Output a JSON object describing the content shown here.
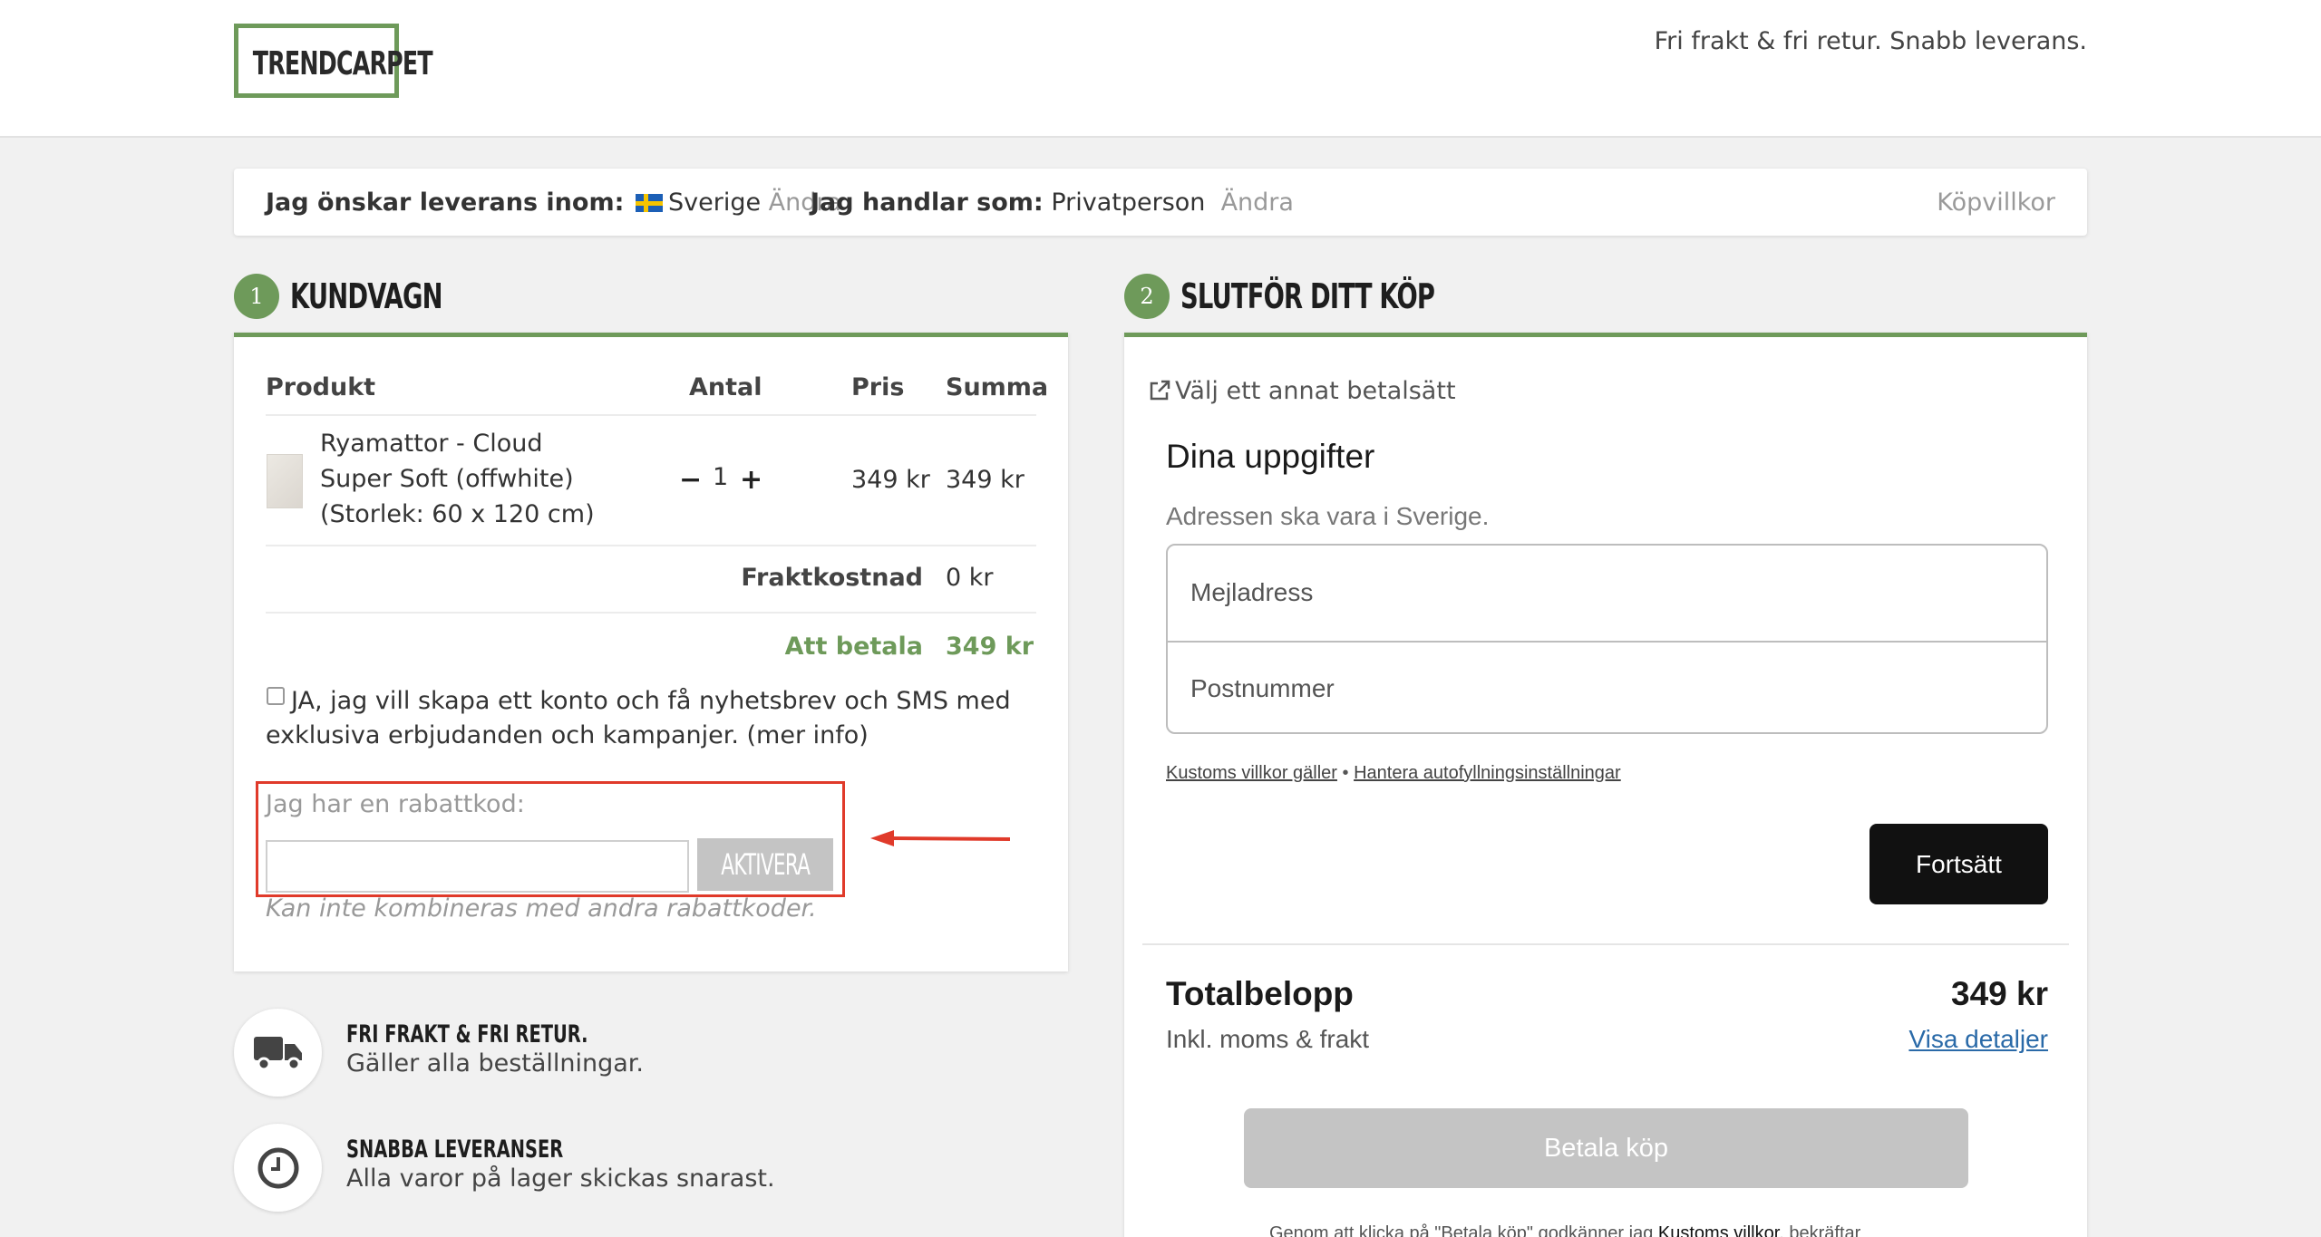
{
  "header": {
    "logo_text": "TRENDCARPET",
    "tagline": "Fri frakt & fri retur. Snabb leverans."
  },
  "delivery_bar": {
    "delivery_label": "Jag önskar leverans inom:",
    "country": "Sverige",
    "change_country": "Ändra",
    "buyer_label": "Jag handlar som:",
    "buyer_type": "Privatperson",
    "change_buyer": "Ändra",
    "terms_link": "Köpvillkor",
    "flag_icon": "sweden-flag-icon"
  },
  "cart": {
    "step_number": "1",
    "title": "KUNDVAGN",
    "headers": {
      "product": "Produkt",
      "quantity": "Antal",
      "price": "Pris",
      "sum": "Summa"
    },
    "items": [
      {
        "name_line1": "Ryamattor - Cloud",
        "name_line2": "Super Soft (offwhite)",
        "name_line3": "(Storlek: 60 x 120 cm)",
        "quantity": "1",
        "price": "349 kr",
        "sum": "349 kr"
      }
    ],
    "shipping_label": "Fraktkostnad",
    "shipping_value": "0 kr",
    "total_label": "Att betala",
    "total_value": "349 kr",
    "consent_text": "JA, jag vill skapa ett konto och få nyhetsbrev och SMS med exklusiva erbjudanden och kampanjer. (mer info)",
    "consent_checked": false,
    "discount_label": "Jag har en rabattkod:",
    "discount_value": "",
    "activate_label": "AKTIVERA",
    "discount_note": "Kan inte kombineras med andra rabattkoder.",
    "highlight_color": "#e03a2a"
  },
  "features": [
    {
      "icon": "truck-icon",
      "title": "FRI FRAKT & FRI RETUR.",
      "subtitle": "Gäller alla beställningar."
    },
    {
      "icon": "clock-icon",
      "title": "SNABBA LEVERANSER",
      "subtitle": "Alla varor på lager skickas snarast."
    }
  ],
  "checkout": {
    "step_number": "2",
    "title": "SLUTFÖR DITT KÖP",
    "other_payment": "Välj ett annat betalsätt",
    "details_title": "Dina uppgifter",
    "address_note": "Adressen ska vara i Sverige.",
    "email_placeholder": "Mejladress",
    "postcode_placeholder": "Postnummer",
    "terms_link": "Kustoms villkor gäller",
    "separator": "•",
    "autofill_link": "Hantera autofyllningsinställningar",
    "continue_label": "Fortsätt",
    "total_label": "Totalbelopp",
    "total_value": "349 kr",
    "total_sub": "Inkl. moms & frakt",
    "details_link": "Visa detaljer",
    "pay_label": "Betala köp",
    "legal_prefix": "Genom att klicka på \"Betala köp\" godkänner jag",
    "legal_link": "Kustoms villkor",
    "legal_suffix": ", bekräftar"
  },
  "colors": {
    "accent": "#6e9a5a",
    "background": "#f1f1f1",
    "button_dark": "#111111",
    "button_disabled": "#c4c4c4",
    "link": "#2a6aa8"
  }
}
